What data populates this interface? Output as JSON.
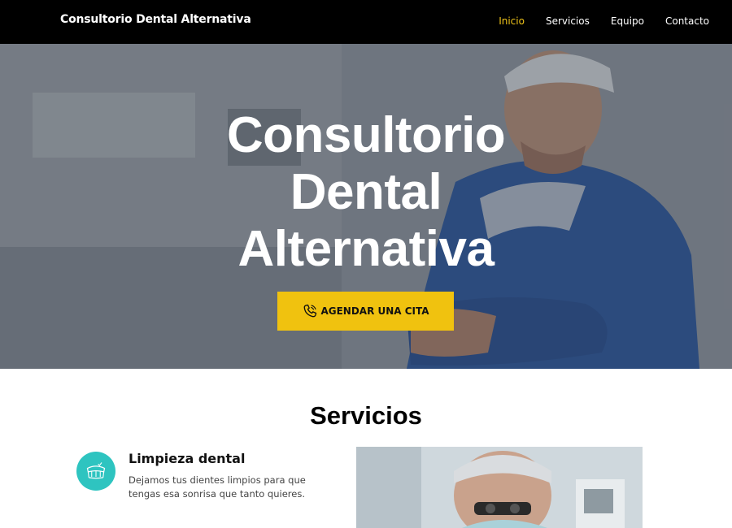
{
  "navbar": {
    "brand": "Consultorio Dental Alternativa",
    "links": [
      {
        "label": "Inicio",
        "active": true
      },
      {
        "label": "Servicios",
        "active": false
      },
      {
        "label": "Equipo",
        "active": false
      },
      {
        "label": "Contacto",
        "active": false
      }
    ]
  },
  "hero": {
    "title_lines": [
      "Consultorio",
      "Dental",
      "Alternativa"
    ],
    "cta_label": "AGENDAR UNA CITA",
    "cta_icon": "phone-icon"
  },
  "services": {
    "heading": "Servicios",
    "items": [
      {
        "name": "Limpieza dental",
        "description": "Dejamos tus dientes limpios para que tengas esa sonrisa que tanto quieres.",
        "icon": "teeth-icon"
      }
    ]
  },
  "colors": {
    "nav_bg": "#000000",
    "accent": "#f0c419",
    "cta_bg": "#f0c20f",
    "service_icon_bg": "#2ec4c0"
  }
}
